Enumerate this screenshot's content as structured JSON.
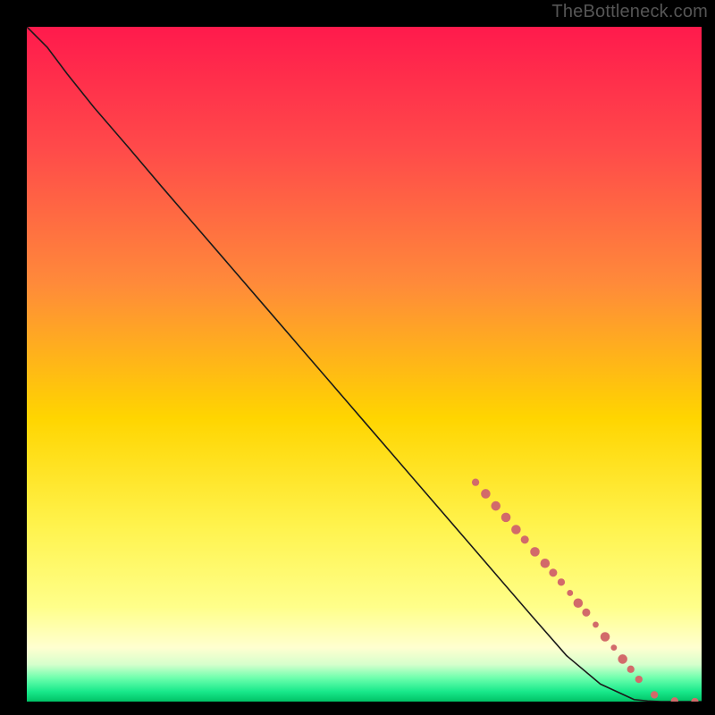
{
  "attribution": "TheBottleneck.com",
  "colors": {
    "page_bg": "#000000",
    "grad_top": "#ff1a4c",
    "grad_mid1": "#ff8a3a",
    "grad_mid2": "#ffd500",
    "grad_mid3": "#fff34d",
    "grad_mid4": "#ffff8a",
    "grad_green_light": "#6dffad",
    "grad_green_mid": "#19e98b",
    "grad_green_bottom": "#00c266",
    "line": "#1a1a1a",
    "dots": "#d26a6a"
  },
  "chart_data": {
    "type": "line",
    "title": "",
    "xlabel": "",
    "ylabel": "",
    "xlim": [
      0,
      100
    ],
    "ylim": [
      0,
      100
    ],
    "series": [
      {
        "name": "curve",
        "x": [
          0,
          3,
          6,
          10,
          15,
          20,
          25,
          30,
          35,
          40,
          45,
          50,
          55,
          60,
          65,
          70,
          75,
          80,
          85,
          90,
          92,
          94,
          100
        ],
        "y": [
          100,
          97,
          93,
          88,
          82.2,
          76.3,
          70.5,
          64.7,
          58.9,
          53.1,
          47.3,
          41.5,
          35.7,
          29.9,
          24.1,
          18.3,
          12.5,
          6.8,
          2.6,
          0.3,
          0.1,
          0,
          0
        ]
      }
    ],
    "dots": [
      {
        "x": 66.5,
        "y": 32.5,
        "r": 0.55
      },
      {
        "x": 68.0,
        "y": 30.8,
        "r": 0.7
      },
      {
        "x": 69.5,
        "y": 29.0,
        "r": 0.7
      },
      {
        "x": 71.0,
        "y": 27.3,
        "r": 0.7
      },
      {
        "x": 72.5,
        "y": 25.5,
        "r": 0.7
      },
      {
        "x": 73.8,
        "y": 24.0,
        "r": 0.6
      },
      {
        "x": 75.3,
        "y": 22.2,
        "r": 0.7
      },
      {
        "x": 76.8,
        "y": 20.5,
        "r": 0.7
      },
      {
        "x": 78.0,
        "y": 19.1,
        "r": 0.6
      },
      {
        "x": 79.2,
        "y": 17.7,
        "r": 0.55
      },
      {
        "x": 80.5,
        "y": 16.1,
        "r": 0.45
      },
      {
        "x": 81.7,
        "y": 14.6,
        "r": 0.7
      },
      {
        "x": 82.9,
        "y": 13.2,
        "r": 0.6
      },
      {
        "x": 84.3,
        "y": 11.4,
        "r": 0.45
      },
      {
        "x": 85.7,
        "y": 9.6,
        "r": 0.7
      },
      {
        "x": 87.0,
        "y": 8.0,
        "r": 0.45
      },
      {
        "x": 88.3,
        "y": 6.3,
        "r": 0.7
      },
      {
        "x": 89.5,
        "y": 4.8,
        "r": 0.55
      },
      {
        "x": 90.7,
        "y": 3.3,
        "r": 0.55
      },
      {
        "x": 93.0,
        "y": 1.0,
        "r": 0.55
      },
      {
        "x": 96.0,
        "y": 0.1,
        "r": 0.55
      },
      {
        "x": 99.0,
        "y": 0.0,
        "r": 0.55
      }
    ]
  }
}
